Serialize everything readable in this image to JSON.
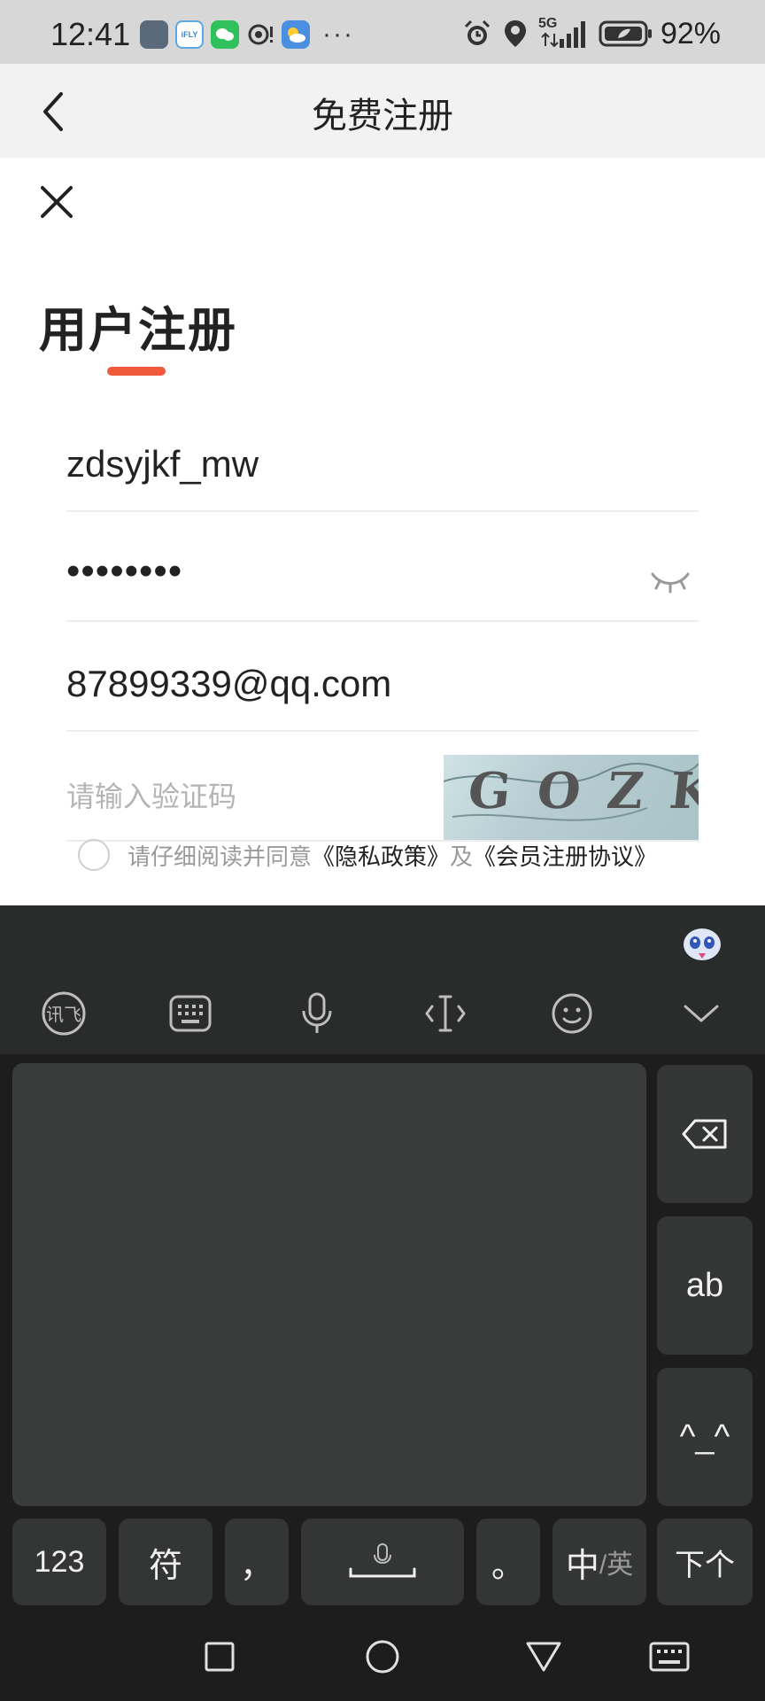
{
  "status_bar": {
    "time": "12:41",
    "app_icons": [
      "app-icon",
      "ifly-icon",
      "wechat-icon",
      "podcast-icon",
      "weather-icon"
    ],
    "more": "···",
    "network": "5G",
    "battery": "92%"
  },
  "title_bar": {
    "title": "免费注册"
  },
  "form": {
    "heading": "用户注册",
    "username": "zdsyjkf_mw",
    "password": "••••••••",
    "email": "87899339@qq.com",
    "captcha_placeholder": "请输入验证码",
    "captcha_text": "GOZK",
    "agree_prefix": "请仔细阅读并同意",
    "privacy_link": "《隐私政策》",
    "agree_and": "及",
    "member_link": "《会员注册协议》"
  },
  "keyboard": {
    "toolbar": [
      "ifly-logo-icon",
      "keyboard-layout-icon",
      "microphone-icon",
      "cursor-icon",
      "emoji-icon",
      "collapse-icon"
    ],
    "key_ab": "ab",
    "key_face": "^_^",
    "key_123": "123",
    "key_symbol": "符",
    "key_comma": "，",
    "key_period": "。",
    "key_lang_main": "中",
    "key_lang_sub": "/英",
    "key_next": "下个"
  },
  "colors": {
    "accent": "#ef5a3c",
    "keyboard_bg": "#1d1d1d",
    "key_bg": "#343535"
  }
}
